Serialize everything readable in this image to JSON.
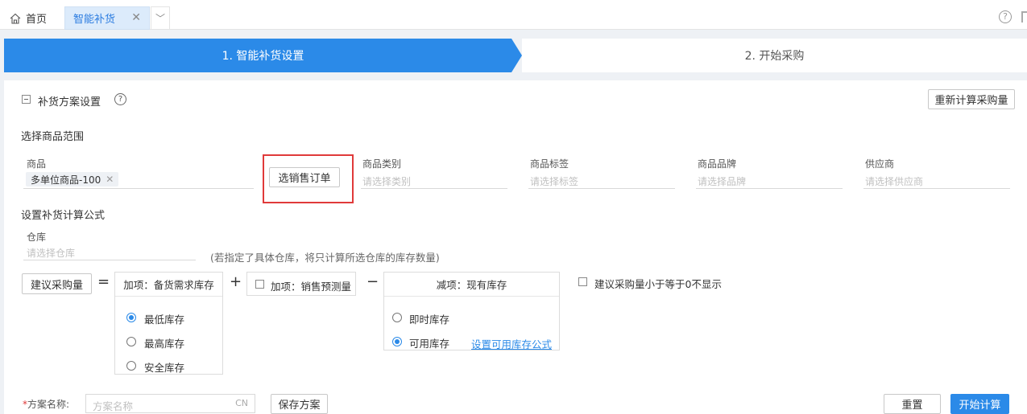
{
  "tabs": {
    "home_label": "首页",
    "active_label": "智能补货",
    "close_glyph": "✕",
    "more_glyph": "﹀",
    "help_glyph": "?"
  },
  "steps": [
    {
      "label": "1. 智能补货设置",
      "active": true
    },
    {
      "label": "2. 开始采购",
      "active": false
    }
  ],
  "section": {
    "title": "补货方案设置",
    "help_glyph": "?",
    "recalc_button": "重新计算采购量"
  },
  "scope": {
    "title": "选择商品范围",
    "product_label": "商品",
    "product_chip": "多单位商品-100",
    "chip_close": "✕",
    "select_order_button": "选销售订单",
    "category_label": "商品类别",
    "category_placeholder": "请选择类别",
    "tag_label": "商品标签",
    "tag_placeholder": "请选择标签",
    "brand_label": "商品品牌",
    "brand_placeholder": "请选择品牌",
    "supplier_label": "供应商",
    "supplier_placeholder": "请选择供应商"
  },
  "formula": {
    "title": "设置补货计算公式",
    "warehouse_label": "仓库",
    "warehouse_placeholder": "请选择仓库",
    "warehouse_note": "(若指定了具体仓库，将只计算所选仓库的库存数量)",
    "suggest_button": "建议采购量",
    "equals": "=",
    "plus": "+",
    "minus": "−",
    "add_box_title": "加项：备货需求库存",
    "add_options": [
      {
        "label": "最低库存",
        "checked": true
      },
      {
        "label": "最高库存",
        "checked": false
      },
      {
        "label": "安全库存",
        "checked": false
      }
    ],
    "forecast_label": "加项：销售预测量",
    "sub_box_title": "减项：现有库存",
    "sub_options": [
      {
        "label": "即时库存",
        "checked": false
      },
      {
        "label": "可用库存",
        "checked": true
      }
    ],
    "sub_link": "设置可用库存公式",
    "hide_zero_label": "建议采购量小于等于0不显示"
  },
  "footer": {
    "required_mark": "*",
    "plan_name_label": "方案名称:",
    "plan_name_placeholder": "方案名称",
    "input_suffix": "CN",
    "save_button": "保存方案",
    "reset_button": "重置",
    "start_button": "开始计算"
  },
  "colors": {
    "accent": "#2b8ae8",
    "highlight_red": "#e03a3a"
  }
}
